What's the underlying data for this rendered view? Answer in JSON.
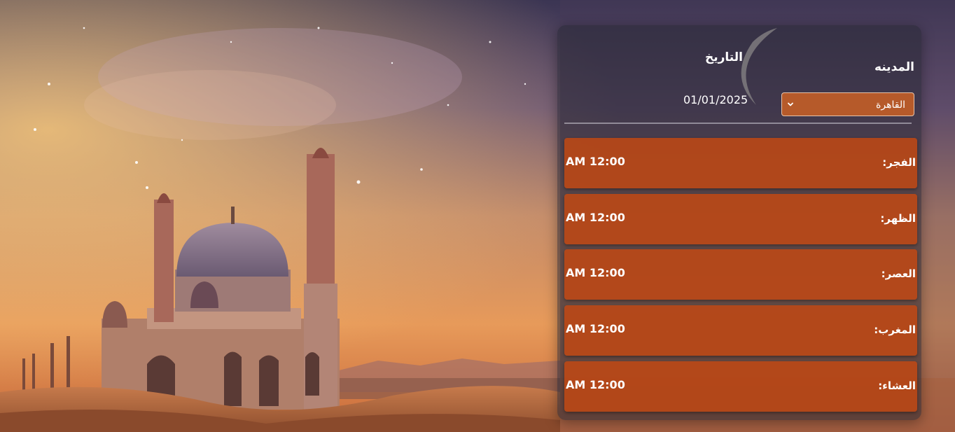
{
  "form": {
    "city_label": "المدينه",
    "date_label": "التاريخ",
    "date_value": "01/01/2025",
    "city_selected": "القاهرة"
  },
  "prayers": [
    {
      "name": "الفجر:",
      "time": "12:00 AM"
    },
    {
      "name": "الظهر:",
      "time": "12:00 AM"
    },
    {
      "name": "العصر:",
      "time": "12:00 AM"
    },
    {
      "name": "المغرب:",
      "time": "12:00 AM"
    },
    {
      "name": "العشاء:",
      "time": "12:00 AM"
    }
  ],
  "colors": {
    "card": "#c04814",
    "select": "#b65a2a",
    "panel": "#28283480"
  },
  "icons": {
    "select_arrow": "chevron-down-icon"
  }
}
